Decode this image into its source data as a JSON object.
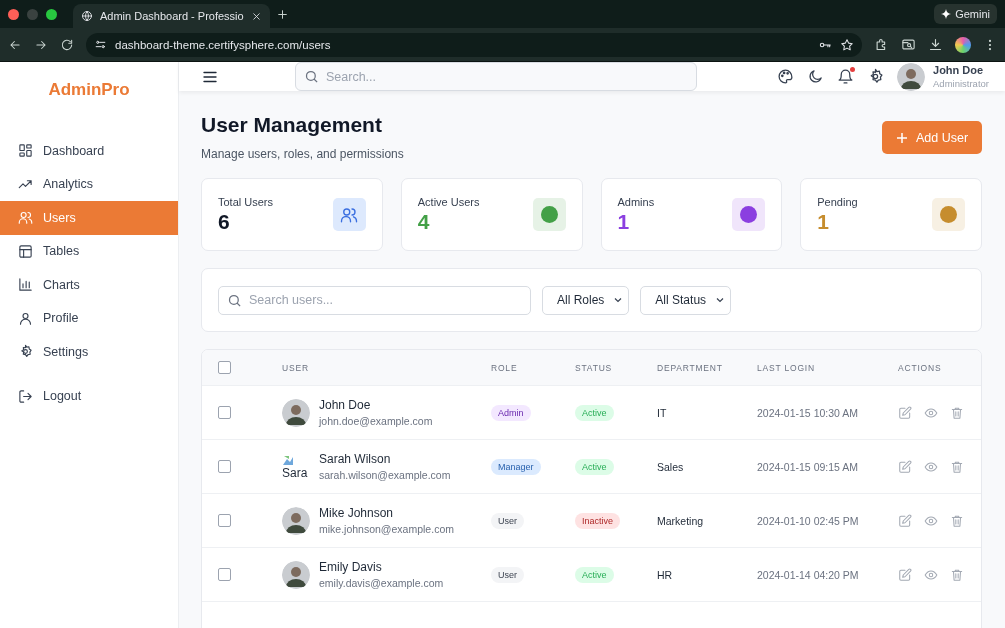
{
  "browser": {
    "tab_title": "Admin Dashboard - Professio",
    "gemini": "Gemini",
    "url": "dashboard-theme.certifysphere.com/users"
  },
  "sidebar": {
    "logo": "AdminPro",
    "items": [
      {
        "label": "Dashboard",
        "selected": false
      },
      {
        "label": "Analytics",
        "selected": false
      },
      {
        "label": "Users",
        "selected": true
      },
      {
        "label": "Tables",
        "selected": false
      },
      {
        "label": "Charts",
        "selected": false
      },
      {
        "label": "Profile",
        "selected": false
      },
      {
        "label": "Settings",
        "selected": false
      }
    ],
    "logout": "Logout"
  },
  "header": {
    "search_placeholder": "Search...",
    "notification_dot": true,
    "user_name": "John Doe",
    "user_role": "Administrator"
  },
  "page": {
    "title": "User Management",
    "subtitle": "Manage users, roles, and permissions",
    "add_button": "Add User"
  },
  "stats": [
    {
      "label": "Total Users",
      "value": "6",
      "color": "#111827"
    },
    {
      "label": "Active Users",
      "value": "4",
      "color": "#43a047"
    },
    {
      "label": "Admins",
      "value": "1",
      "color": "#8b3fe0"
    },
    {
      "label": "Pending",
      "value": "1",
      "color": "#c68d2e"
    }
  ],
  "filters": {
    "search_placeholder": "Search users...",
    "role": "All Roles",
    "status": "All Status"
  },
  "table": {
    "select_all_checked": false,
    "columns": [
      "USER",
      "ROLE",
      "STATUS",
      "DEPARTMENT",
      "LAST LOGIN",
      "ACTIONS"
    ],
    "rows": [
      {
        "checked": false,
        "kind": "photo",
        "name": "John Doe",
        "email": "john.doe@example.com",
        "role": {
          "label": "Admin",
          "color": "#f3e8ff"
        },
        "status": {
          "label": "Active",
          "color": "#dcfce7"
        },
        "department": "IT",
        "last_login": "2024-01-15 10:30 AM"
      },
      {
        "checked": false,
        "kind": "broken",
        "avatar_alt": "Sara",
        "name": "Sarah Wilson",
        "email": "sarah.wilson@example.com",
        "role": {
          "label": "Manager",
          "color": "#dbeafe"
        },
        "status": {
          "label": "Active",
          "color": "#dcfce7"
        },
        "department": "Sales",
        "last_login": "2024-01-15 09:15 AM"
      },
      {
        "checked": false,
        "kind": "photo",
        "name": "Mike Johnson",
        "email": "mike.johnson@example.com",
        "role": {
          "label": "User",
          "color": "#f3f4f6"
        },
        "status": {
          "label": "Inactive",
          "color": "#fee2e2"
        },
        "department": "Marketing",
        "last_login": "2024-01-10 02:45 PM"
      },
      {
        "checked": false,
        "kind": "photo",
        "name": "Emily Davis",
        "email": "emily.davis@example.com",
        "role": {
          "label": "User",
          "color": "#f3f4f6"
        },
        "status": {
          "label": "Active",
          "color": "#dcfce7"
        },
        "department": "HR",
        "last_login": "2024-01-14 04:20 PM"
      }
    ]
  }
}
